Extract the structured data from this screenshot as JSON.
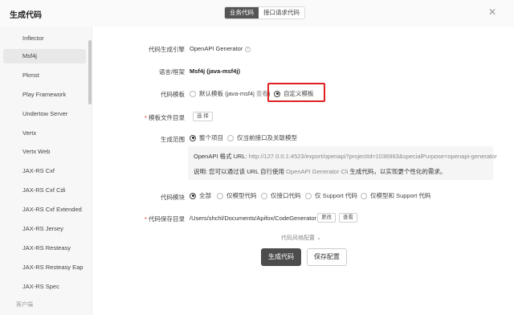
{
  "window": {
    "title": "生成代码"
  },
  "tabs": [
    {
      "label": "业务代码",
      "active": true
    },
    {
      "label": "接口请求代码",
      "active": false
    }
  ],
  "sidebar": {
    "items": [
      {
        "label": "Inflector"
      },
      {
        "label": "Msf4j",
        "active": true
      },
      {
        "label": "Pkmst"
      },
      {
        "label": "Play Framework"
      },
      {
        "label": "Undertow Server"
      },
      {
        "label": "Vertx"
      },
      {
        "label": "Vertx Web"
      },
      {
        "label": "JAX-RS Cxf"
      },
      {
        "label": "JAX-RS Cxf Cdi"
      },
      {
        "label": "JAX-RS Cxf Extended"
      },
      {
        "label": "JAX-RS Jersey"
      },
      {
        "label": "JAX-RS Resteasy"
      },
      {
        "label": "JAX-RS Resteasy Eap"
      },
      {
        "label": "JAX-RS Spec"
      }
    ],
    "footer": "客户端"
  },
  "form": {
    "engine": {
      "label": "代码生成引擎",
      "value": "OpenAPI Generator",
      "icon": "info-icon"
    },
    "lang": {
      "label": "语言/框架",
      "value": "Msf4j (java-msf4j)"
    },
    "template": {
      "label": "代码模板",
      "options": [
        {
          "label": "默认模板 (java-msf4j",
          "link": "查看",
          "suffix": ")"
        },
        {
          "label": "自定义模板",
          "selected": true
        }
      ]
    },
    "template_dir": {
      "label": "模板文件目录",
      "button": "选 择"
    },
    "scope": {
      "label": "生成范围",
      "options": [
        "整个项目",
        "仅当前接口及关联模型"
      ],
      "url_label": "OpenAPI 格式 URL:",
      "url": "http://127.0.0.1:4523/export/openapi?projectId=1036963&specialPurpose=openapi-generator",
      "note_prefix": "说明: 您可以通过该 URL 自行使用",
      "note_link": "OpenAPI Generator Cli",
      "note_suffix": "生成代码，以实现更个性化的需求。"
    },
    "modules": {
      "label": "代码模块",
      "options": [
        "全部",
        "仅模型代码",
        "仅接口代码",
        "仅 Support 代码",
        "仅模型和 Support 代码"
      ]
    },
    "save_dir": {
      "label": "代码保存目录",
      "value": "/Users/shchl/Documents/Apifox/CodeGenerator",
      "change": "更改",
      "view": "查看"
    },
    "style_toggle": "代码风格配置",
    "generate_button": "生成代码",
    "save_button": "保存配置"
  },
  "colors": {
    "primary_button": "#4d4d4d",
    "highlight": "#e02020",
    "required": "#e02020"
  }
}
